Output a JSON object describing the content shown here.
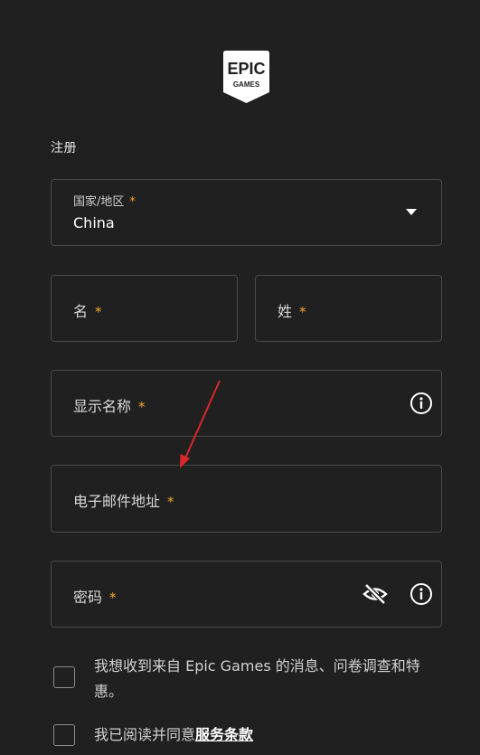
{
  "brand": {
    "line1": "EPIC",
    "line2": "GAMES"
  },
  "form": {
    "title": "注册",
    "required_mark": "*",
    "country": {
      "label": "国家/地区",
      "value": "China"
    },
    "first_name": {
      "label": "名"
    },
    "last_name": {
      "label": "姓"
    },
    "display_name": {
      "label": "显示名称"
    },
    "email": {
      "label": "电子邮件地址"
    },
    "password": {
      "label": "密码"
    }
  },
  "consents": {
    "marketing": {
      "text": "我想收到来自 Epic Games 的消息、问卷调查和特惠。",
      "checked": false
    },
    "terms": {
      "prefix": "我已阅读并同意",
      "link": "服务条款",
      "checked": false
    }
  },
  "icons": {
    "dropdown": "chevron-down-icon",
    "info": "info-icon",
    "visibility": "eye-off-icon"
  },
  "colors": {
    "background": "#202020",
    "required": "#f5a623",
    "annotation_arrow": "#d9262b"
  }
}
